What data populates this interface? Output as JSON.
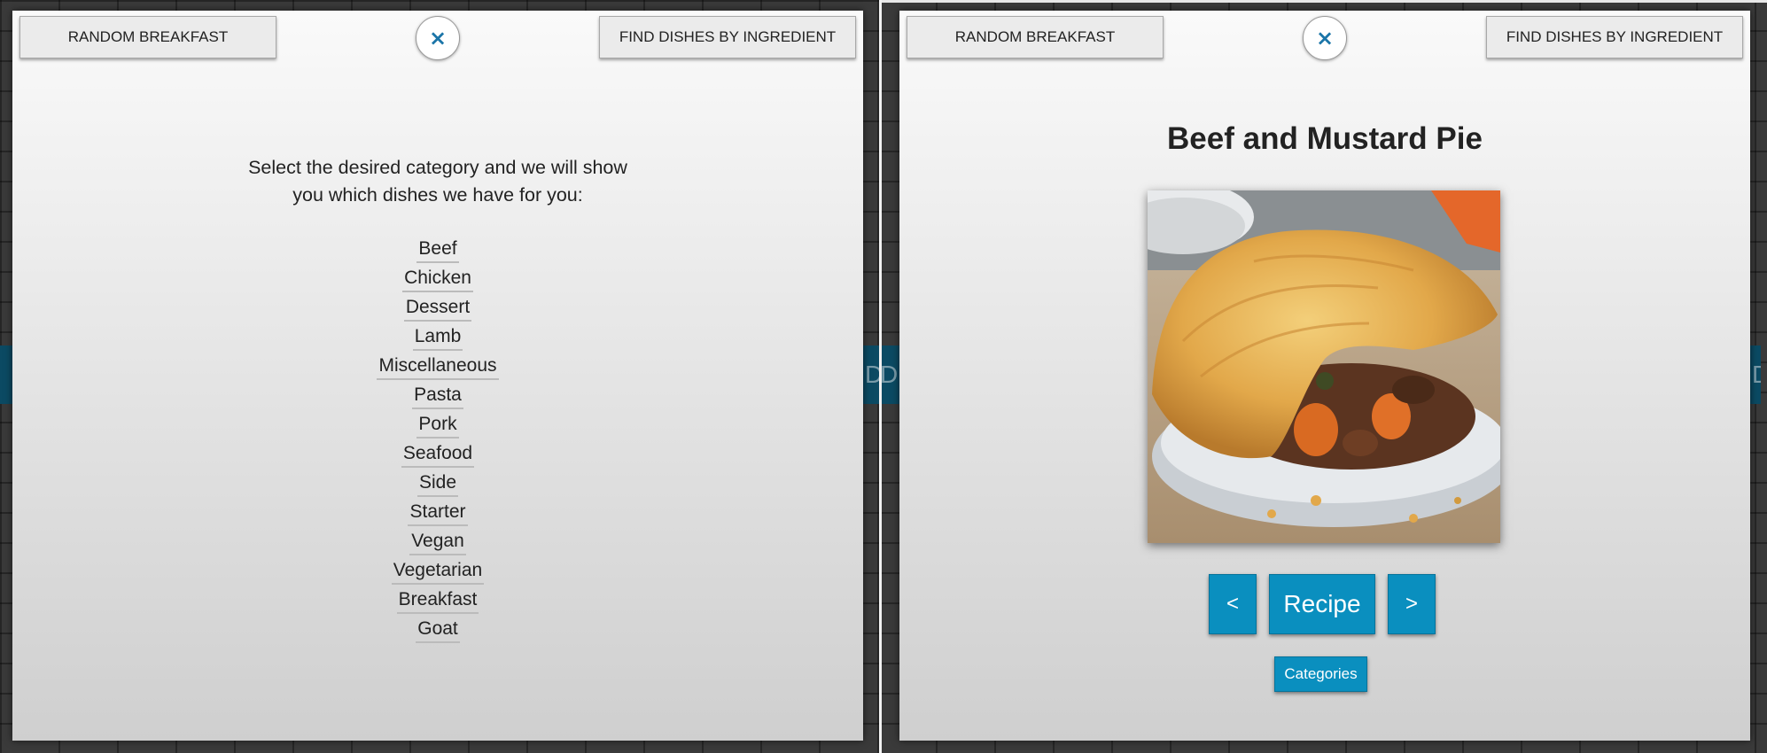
{
  "left": {
    "topbar": {
      "random_label": "Random Breakfast",
      "close_glyph": "×",
      "find_label": "Find dishes by ingredient"
    },
    "intro": {
      "line1": "Select the desired category and we will show",
      "line2": "you which dishes we have for you:"
    },
    "categories": [
      "Beef",
      "Chicken",
      "Dessert",
      "Lamb",
      "Miscellaneous",
      "Pasta",
      "Pork",
      "Seafood",
      "Side",
      "Starter",
      "Vegan",
      "Vegetarian",
      "Breakfast",
      "Goat"
    ],
    "background_text": {
      "right_fragment": "D"
    }
  },
  "right": {
    "topbar": {
      "random_label": "Random Breakfast",
      "close_glyph": "×",
      "find_label": "Find dishes by ingredient"
    },
    "dish": {
      "title": "Beef and Mustard Pie",
      "image_icon": "food-photo-pie"
    },
    "controls": {
      "prev_label": "<",
      "recipe_label": "Recipe",
      "next_label": ">",
      "categories_label": "Categories"
    },
    "background_text": {
      "left_fragment": "D",
      "right_fragment": "D"
    }
  },
  "colors": {
    "accent_blue": "#0a8fbf",
    "close_icon_blue": "#1b75a8",
    "backdrop_teal": "#0b4a63"
  }
}
